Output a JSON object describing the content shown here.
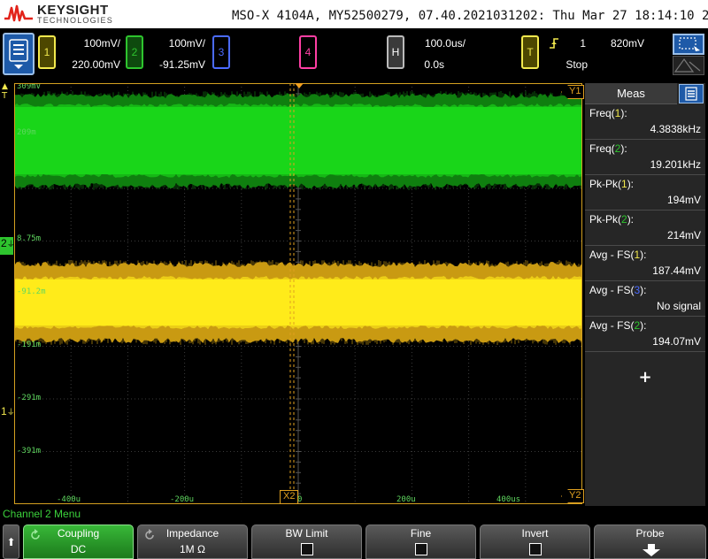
{
  "brand": {
    "name": "KEYSIGHT",
    "sub": "TECHNOLOGIES"
  },
  "instrument_info": "MSO-X 4104A, MY52500279, 07.40.2021031202: Thu Mar 27 18:14:10 2025",
  "channels": [
    {
      "num": "1",
      "scale": "100mV/",
      "offset": "220.00mV",
      "color": "#f2e94e"
    },
    {
      "num": "2",
      "scale": "100mV/",
      "offset": "-91.25mV",
      "color": "#2ec42e"
    },
    {
      "num": "3",
      "scale": "",
      "offset": "",
      "color": "#4b6bff"
    },
    {
      "num": "4",
      "scale": "",
      "offset": "",
      "color": "#ff3fa4"
    }
  ],
  "horizontal": {
    "key": "H",
    "scale": "100.0us/",
    "delay": "0.0s"
  },
  "trigger": {
    "key": "T",
    "edge_icon": "rising-edge-icon",
    "source": "1",
    "level": "820mV",
    "state": "Stop"
  },
  "graticule": {
    "y_labels": [
      "309mV",
      "209m",
      "8.75m",
      "-91.2m",
      "-191m",
      "-291m",
      "-391m"
    ],
    "x_labels": [
      "-400u",
      "-200u",
      "0",
      "200u",
      "400us"
    ],
    "markers": {
      "y1": "Y1",
      "y2": "Y2",
      "x2": "X2",
      "trig": "T",
      "ch2_ground": "2",
      "ch1_ground": "1"
    }
  },
  "measurements": {
    "title": "Meas",
    "rows": [
      {
        "label": "Freq(",
        "src": "1",
        "close": "):",
        "value": "4.3838kHz",
        "src_color": "#f2e94e"
      },
      {
        "label": "Freq(",
        "src": "2",
        "close": "):",
        "value": "19.201kHz",
        "src_color": "#2ec42e"
      },
      {
        "label": "Pk-Pk(",
        "src": "1",
        "close": "):",
        "value": "194mV",
        "src_color": "#f2e94e"
      },
      {
        "label": "Pk-Pk(",
        "src": "2",
        "close": "):",
        "value": "214mV",
        "src_color": "#2ec42e"
      },
      {
        "label": "Avg - FS(",
        "src": "1",
        "close": "):",
        "value": "187.44mV",
        "src_color": "#f2e94e"
      },
      {
        "label": "Avg - FS(",
        "src": "3",
        "close": "):",
        "value": "No signal",
        "src_color": "#4b6bff"
      },
      {
        "label": "Avg - FS(",
        "src": "2",
        "close": "):",
        "value": "194.07mV",
        "src_color": "#2ec42e"
      }
    ],
    "add_label": "+"
  },
  "softkeys": {
    "menu_title": "Channel 2 Menu",
    "back": "⬆",
    "items": [
      {
        "label": "Coupling",
        "value": "DC"
      },
      {
        "label": "Impedance",
        "value": "1M Ω"
      },
      {
        "label": "BW Limit",
        "value": ""
      },
      {
        "label": "Fine",
        "value": ""
      },
      {
        "label": "Invert",
        "value": ""
      },
      {
        "label": "Probe",
        "value": ""
      }
    ]
  }
}
